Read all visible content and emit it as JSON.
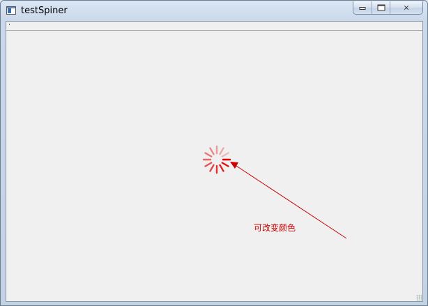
{
  "window": {
    "title": "testSpiner"
  },
  "caption": {
    "minimize_icon": "minimize-icon",
    "maximize_icon": "maximize-icon",
    "close_icon": "close-icon",
    "close_glyph": "⨯"
  },
  "spinner": {
    "color": "#e00000",
    "segments": 12
  },
  "annotation": {
    "label": "可改变颜色",
    "color": "#cc0000"
  }
}
